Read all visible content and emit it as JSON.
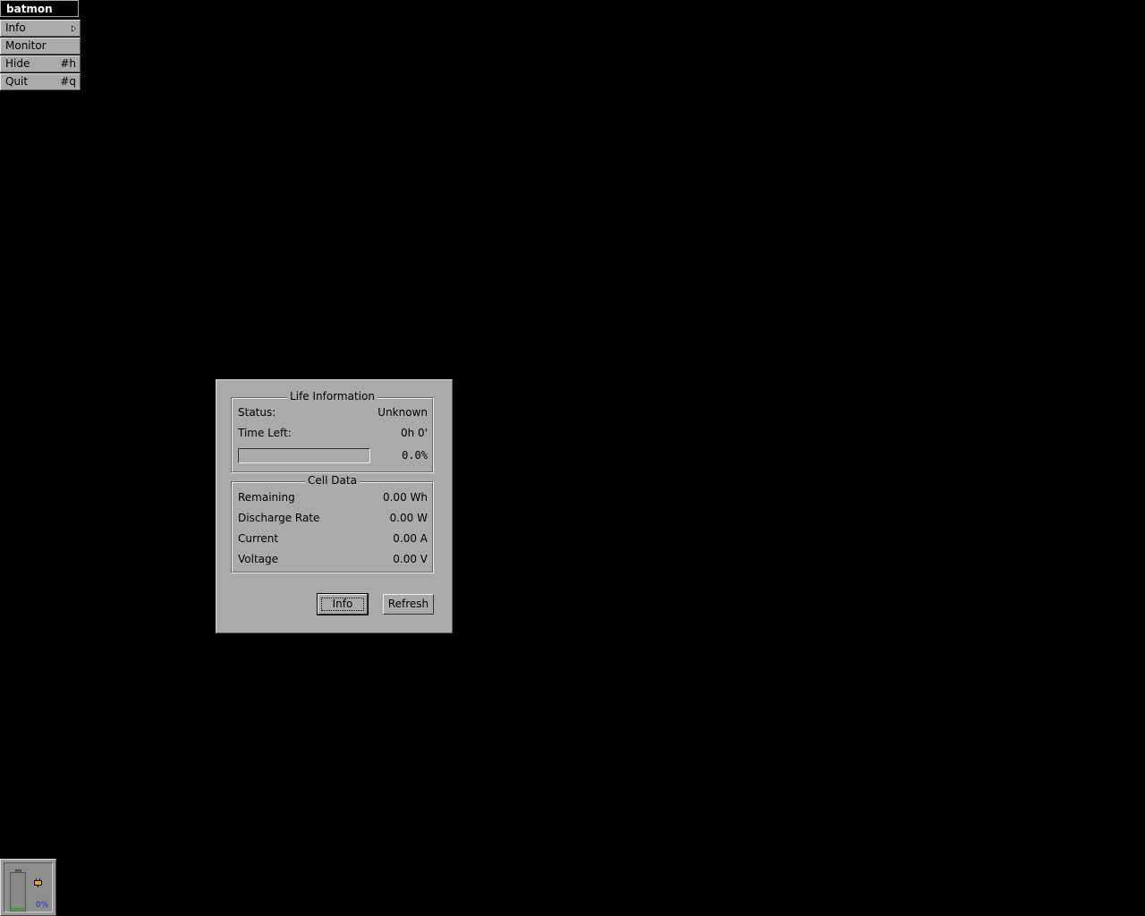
{
  "menu": {
    "title": "batmon",
    "items": [
      {
        "label": "Info",
        "shortcut": "",
        "submenu": true
      },
      {
        "label": "Monitor",
        "shortcut": "",
        "submenu": false
      },
      {
        "label": "Hide",
        "shortcut": "#h",
        "submenu": false
      },
      {
        "label": "Quit",
        "shortcut": "#q",
        "submenu": false
      }
    ]
  },
  "dialog": {
    "life": {
      "title": "Life Information",
      "status_label": "Status:",
      "status_value": "Unknown",
      "time_label": "Time Left:",
      "time_value": "0h 0'",
      "charge_fraction": 0.0,
      "charge_percent": "0.0%"
    },
    "cell": {
      "title": "Cell Data",
      "rows": [
        {
          "label": "Remaining",
          "value": "0.00 Wh"
        },
        {
          "label": "Discharge Rate",
          "value": "0.00 W"
        },
        {
          "label": "Current",
          "value": "0.00 A"
        },
        {
          "label": "Voltage",
          "value": "0.00 V"
        }
      ]
    },
    "buttons": {
      "info": "Info",
      "refresh": "Refresh"
    }
  },
  "dock": {
    "percent_text": "0%",
    "level_fraction": 0.0,
    "colors": {
      "level": "#1fb31f",
      "percent_text": "#1a2fe0",
      "plug": "#e0b000"
    }
  }
}
